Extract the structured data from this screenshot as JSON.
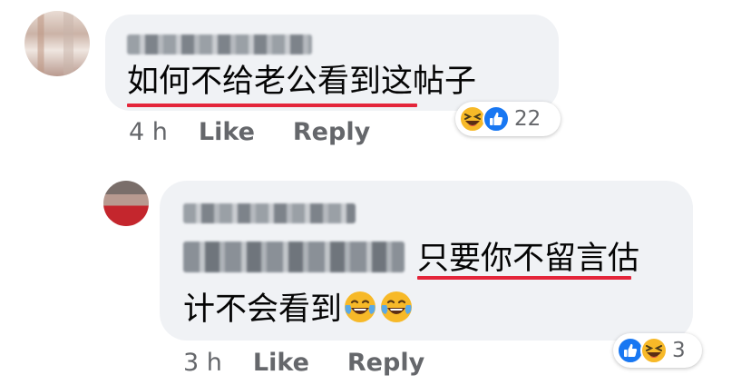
{
  "comments": [
    {
      "text": "如何不给老公看到这帖子",
      "reaction_icons": [
        "laugh-reaction-icon",
        "like-reaction-icon"
      ],
      "reaction_count": "22",
      "time": "4 h",
      "like_label": "Like",
      "reply_label": "Reply"
    },
    {
      "text_line1": "只要你不留言估",
      "text_line2": "计不会看到",
      "inline_emojis": [
        "tears-of-joy-emoji",
        "tears-of-joy-emoji"
      ],
      "reaction_icons": [
        "like-reaction-icon",
        "laugh-reaction-icon"
      ],
      "reaction_count": "3",
      "time": "3 h",
      "like_label": "Like",
      "reply_label": "Reply"
    }
  ],
  "colors": {
    "bubble": "#f0f2f5",
    "meta_text": "#65676b",
    "underline": "#e4253a",
    "like_blue": "#1877f2",
    "emoji_yellow": "#f7b928"
  }
}
